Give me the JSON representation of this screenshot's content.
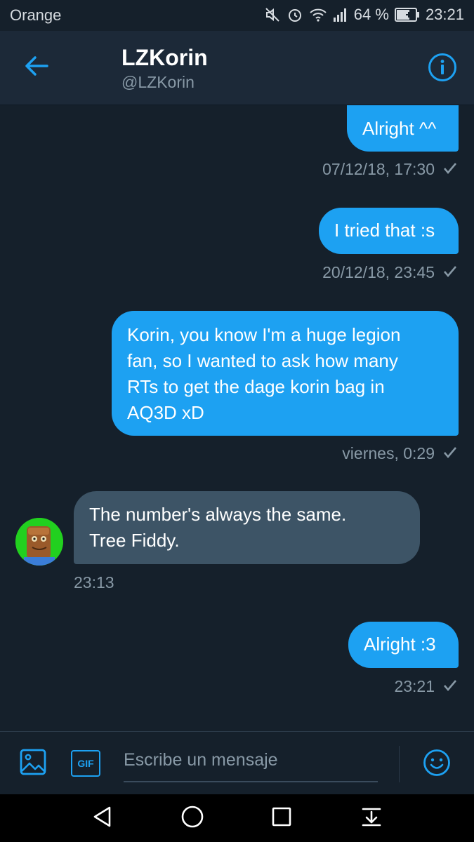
{
  "status_bar": {
    "carrier": "Orange",
    "battery": "64 %",
    "time": "23:21"
  },
  "header": {
    "name": "LZKorin",
    "handle": "@LZKorin"
  },
  "messages": [
    {
      "direction": "out",
      "text": "Alright ^^",
      "meta": "07/12/18, 17:30"
    },
    {
      "direction": "out",
      "text": "I tried that :s",
      "meta": "20/12/18, 23:45"
    },
    {
      "direction": "out",
      "text_lines": [
        "Korin, you know I'm a huge legion",
        "fan, so I wanted to ask how many",
        "RTs to get the dage korin bag in",
        "AQ3D xD"
      ],
      "meta": "viernes, 0:29"
    },
    {
      "direction": "in",
      "text_lines": [
        "The number's always the same.",
        "Tree Fiddy."
      ],
      "meta": "23:13"
    },
    {
      "direction": "out",
      "text": "Alright :3",
      "meta": "23:21"
    }
  ],
  "composer": {
    "placeholder": "Escribe un mensaje",
    "gif_label": "GIF"
  },
  "icons": {
    "back": "arrow-left-icon",
    "info": "info-icon",
    "image": "image-icon",
    "gif": "gif-icon",
    "emoji": "emoji-icon",
    "sent": "checkmark-icon"
  },
  "colors": {
    "accent": "#1da1f2",
    "background": "#15202b",
    "header": "#1c2938",
    "incoming_bubble": "#3d5466",
    "muted_text": "#8899a6"
  }
}
